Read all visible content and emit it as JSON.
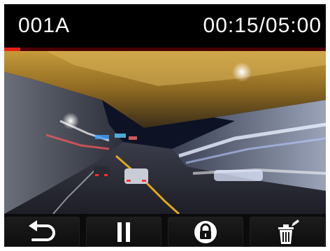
{
  "clip": {
    "id": "001A",
    "timecode": "00:15/05:00",
    "progress": 0.05
  },
  "controls": {
    "back": {
      "icon": "back-arrow-icon"
    },
    "pause": {
      "icon": "pause-icon"
    },
    "lock": {
      "icon": "lock-icon"
    },
    "delete": {
      "icon": "trash-icon"
    }
  },
  "colors": {
    "accent": "#e8201a",
    "bar_background": "#000000",
    "text": "#ffffff"
  }
}
